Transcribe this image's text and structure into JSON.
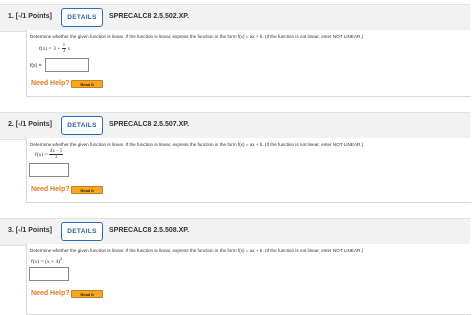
{
  "problems": [
    {
      "number": "1.",
      "points": "[-/1 Points]",
      "details_label": "DETAILS",
      "id": "SPRECALC8 2.5.502.XP.",
      "instruction": "Determine whether the given function is linear. If the function is linear, express the function in the form  f(x) = ax + b.  (If the function is not linear, enter NOT LINEAR.)",
      "function_prefix": "f(x) = 3 +",
      "function_frac_num": "1",
      "function_frac_den": "3",
      "function_suffix": "x",
      "answer_label": "f(x) =",
      "answer_value": "",
      "need_help": "Need Help?",
      "read_it": "Read It"
    },
    {
      "number": "2.",
      "points": "[-/1 Points]",
      "details_label": "DETAILS",
      "id": "SPRECALC8 2.5.507.XP.",
      "instruction": "Determine whether the given function is linear. If the function is linear, express the function in the form  f(x) = ax + b.  (If the function is not linear, enter NOT LINEAR.)",
      "function_prefix": "f(x) =",
      "function_frac_num": "4x − 5",
      "function_frac_den": "x",
      "answer_value": "",
      "need_help": "Need Help?",
      "read_it": "Read It"
    },
    {
      "number": "3.",
      "points": "[-/1 Points]",
      "details_label": "DETAILS",
      "id": "SPRECALC8 2.5.508.XP.",
      "instruction": "Determine whether the given function is linear. If the function is linear, express the function in the form  f(x) = ax + b.  (If the function is not linear, enter NOT LINEAR.)",
      "function_text": "f(x) = (x + 4)",
      "function_exponent": "2",
      "answer_value": "",
      "need_help": "Need Help?",
      "read_it": "Read It"
    }
  ]
}
